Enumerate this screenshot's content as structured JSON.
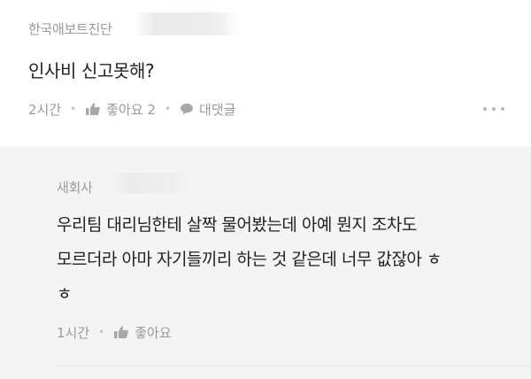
{
  "comment": {
    "author": "한국애보트진단",
    "text": "인사비 신고못해?",
    "time": "2시간",
    "like_label": "좋아요 2",
    "reply_label": "대댓글",
    "icons": {
      "like": "thumbs-up-icon",
      "reply": "speech-bubble-icon",
      "more": "more-dots-icon"
    }
  },
  "reply": {
    "author": "새회사",
    "text_lines": [
      "우리팀 대리님한테 살짝 물어봤는데 아예 뭔지 조차도",
      "모르더라 아마 자기들끼리 하는 것 같은데 너무 값잖아 ㅎ",
      "ㅎ"
    ],
    "time": "1시간",
    "like_label": "좋아요"
  },
  "colors": {
    "text_primary": "#222222",
    "text_meta": "#9a9a9a",
    "reply_background": "#f4f4f4"
  }
}
